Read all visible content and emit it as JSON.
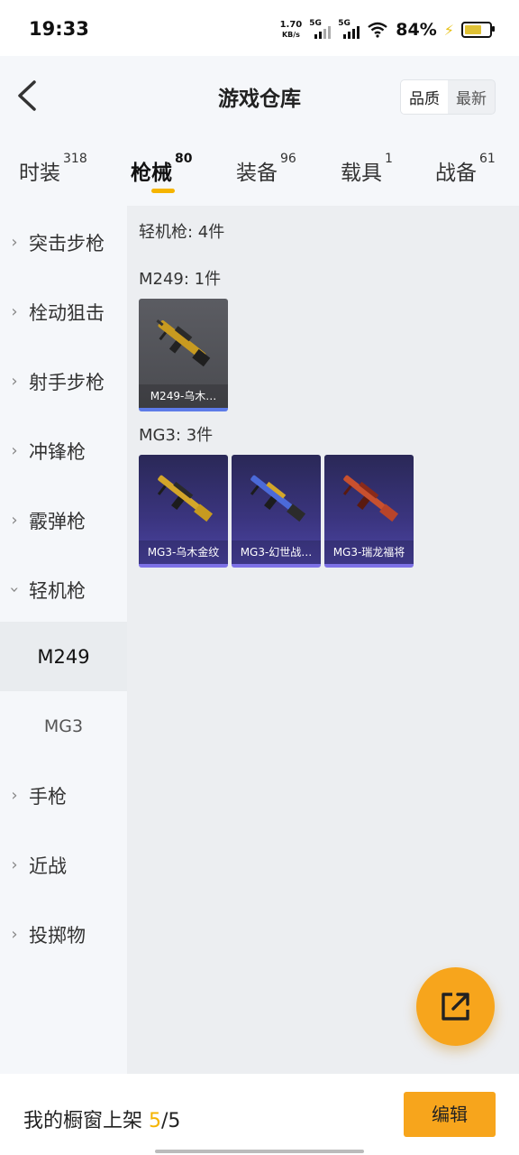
{
  "status": {
    "time": "19:33",
    "speed_value": "1.70",
    "speed_unit": "KB/s",
    "sig1_label": "5G",
    "sig2_label": "5G",
    "battery_pct": "84%",
    "battery_level": 0.84
  },
  "header": {
    "title": "游戏仓库",
    "sort_quality": "品质",
    "sort_latest": "最新"
  },
  "tabs": [
    {
      "label": "时装",
      "count": "318"
    },
    {
      "label": "枪械",
      "count": "80"
    },
    {
      "label": "装备",
      "count": "96"
    },
    {
      "label": "载具",
      "count": "1"
    },
    {
      "label": "战备",
      "count": "61"
    }
  ],
  "sidebar": {
    "items": [
      {
        "label": "突击步枪"
      },
      {
        "label": "栓动狙击"
      },
      {
        "label": "射手步枪"
      },
      {
        "label": "冲锋枪"
      },
      {
        "label": "霰弹枪"
      },
      {
        "label": "轻机枪"
      },
      {
        "label": "手枪"
      },
      {
        "label": "近战"
      },
      {
        "label": "投掷物"
      }
    ],
    "subitems": [
      {
        "label": "M249"
      },
      {
        "label": "MG3"
      }
    ]
  },
  "content": {
    "category_header": "轻机枪: 4件",
    "groups": [
      {
        "header": "M249: 1件",
        "items": [
          {
            "name": "M249-乌木…"
          }
        ]
      },
      {
        "header": "MG3: 3件",
        "items": [
          {
            "name": "MG3-乌木金纹"
          },
          {
            "name": "MG3-幻世战…"
          },
          {
            "name": "MG3-瑞龙福将"
          }
        ]
      }
    ]
  },
  "bottom": {
    "label": "我的橱窗上架 ",
    "count": "5",
    "total": "/5",
    "edit_label": "编辑"
  },
  "colors": {
    "accent": "#f5b400",
    "fab": "#f7a51c"
  }
}
